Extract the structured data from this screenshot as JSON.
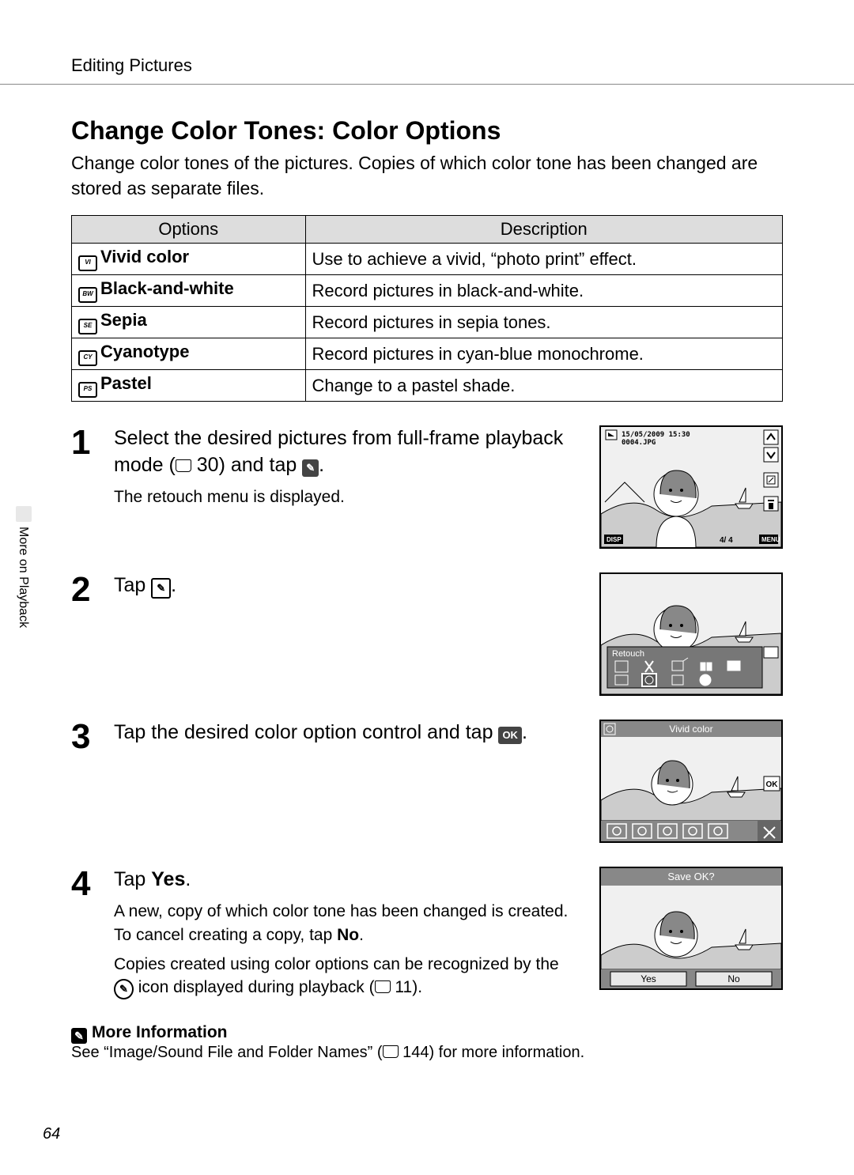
{
  "header": "Editing Pictures",
  "title": "Change Color Tones: Color Options",
  "intro": "Change color tones of the pictures. Copies of which color tone has been changed are stored as separate files.",
  "table": {
    "head_opt": "Options",
    "head_desc": "Description",
    "rows": [
      {
        "name": "Vivid color",
        "desc": "Use to achieve a vivid, “photo print” effect."
      },
      {
        "name": "Black-and-white",
        "desc": "Record pictures in black-and-white."
      },
      {
        "name": "Sepia",
        "desc": "Record pictures in sepia tones."
      },
      {
        "name": "Cyanotype",
        "desc": "Record pictures in cyan-blue monochrome."
      },
      {
        "name": "Pastel",
        "desc": "Change to a pastel shade."
      }
    ]
  },
  "steps": {
    "s1_num": "1",
    "s1_a": "Select the desired pictures from full-frame playback mode (",
    "s1_ref": " 30) and tap ",
    "s1_end": ".",
    "s1_detail": "The retouch menu is displayed.",
    "s2_num": "2",
    "s2_a": "Tap ",
    "s2_end": ".",
    "s3_num": "3",
    "s3_a": "Tap the desired color option control and tap ",
    "s3_end": ".",
    "s4_num": "4",
    "s4_a": "Tap ",
    "s4_bold": "Yes",
    "s4_end": ".",
    "s4_d1a": "A new, copy of which color tone has been changed is created. To cancel creating a copy, tap ",
    "s4_d1b": "No",
    "s4_d1c": ".",
    "s4_d2a": "Copies created using color options can be recognized by the ",
    "s4_d2b": " icon displayed during playback (",
    "s4_d2c": " 11)."
  },
  "side_tab": "More on Playback",
  "more": {
    "head": "More Information",
    "body_a": "See “Image/Sound File and Folder Names” (",
    "body_b": " 144) for more information."
  },
  "page_num": "64",
  "screens": {
    "s1_date": "15/05/2009 15:30",
    "s1_file": "0004.JPG",
    "s1_counter": "4/    4",
    "s1_disp": "DISP",
    "s1_menu": "MENU",
    "s2_label": "Retouch",
    "s3_label": "Vivid color",
    "s3_ok": "OK",
    "s4_label": "Save OK?",
    "s4_yes": "Yes",
    "s4_no": "No"
  }
}
